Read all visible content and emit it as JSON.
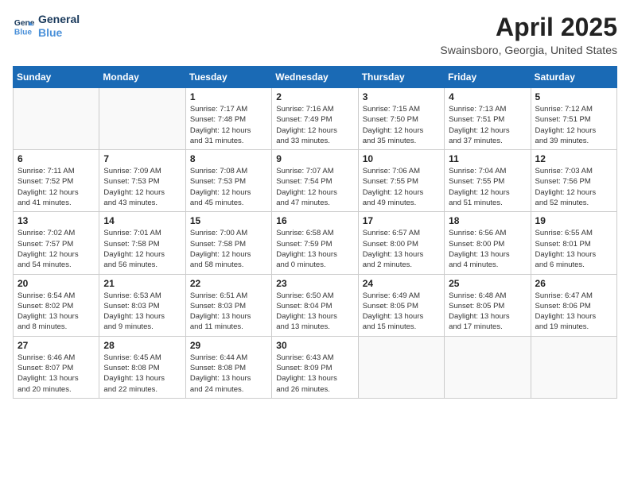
{
  "logo": {
    "line1": "General",
    "line2": "Blue"
  },
  "title": "April 2025",
  "location": "Swainsboro, Georgia, United States",
  "days_of_week": [
    "Sunday",
    "Monday",
    "Tuesday",
    "Wednesday",
    "Thursday",
    "Friday",
    "Saturday"
  ],
  "weeks": [
    [
      {
        "day": "",
        "info": ""
      },
      {
        "day": "",
        "info": ""
      },
      {
        "day": "1",
        "info": "Sunrise: 7:17 AM\nSunset: 7:48 PM\nDaylight: 12 hours\nand 31 minutes."
      },
      {
        "day": "2",
        "info": "Sunrise: 7:16 AM\nSunset: 7:49 PM\nDaylight: 12 hours\nand 33 minutes."
      },
      {
        "day": "3",
        "info": "Sunrise: 7:15 AM\nSunset: 7:50 PM\nDaylight: 12 hours\nand 35 minutes."
      },
      {
        "day": "4",
        "info": "Sunrise: 7:13 AM\nSunset: 7:51 PM\nDaylight: 12 hours\nand 37 minutes."
      },
      {
        "day": "5",
        "info": "Sunrise: 7:12 AM\nSunset: 7:51 PM\nDaylight: 12 hours\nand 39 minutes."
      }
    ],
    [
      {
        "day": "6",
        "info": "Sunrise: 7:11 AM\nSunset: 7:52 PM\nDaylight: 12 hours\nand 41 minutes."
      },
      {
        "day": "7",
        "info": "Sunrise: 7:09 AM\nSunset: 7:53 PM\nDaylight: 12 hours\nand 43 minutes."
      },
      {
        "day": "8",
        "info": "Sunrise: 7:08 AM\nSunset: 7:53 PM\nDaylight: 12 hours\nand 45 minutes."
      },
      {
        "day": "9",
        "info": "Sunrise: 7:07 AM\nSunset: 7:54 PM\nDaylight: 12 hours\nand 47 minutes."
      },
      {
        "day": "10",
        "info": "Sunrise: 7:06 AM\nSunset: 7:55 PM\nDaylight: 12 hours\nand 49 minutes."
      },
      {
        "day": "11",
        "info": "Sunrise: 7:04 AM\nSunset: 7:55 PM\nDaylight: 12 hours\nand 51 minutes."
      },
      {
        "day": "12",
        "info": "Sunrise: 7:03 AM\nSunset: 7:56 PM\nDaylight: 12 hours\nand 52 minutes."
      }
    ],
    [
      {
        "day": "13",
        "info": "Sunrise: 7:02 AM\nSunset: 7:57 PM\nDaylight: 12 hours\nand 54 minutes."
      },
      {
        "day": "14",
        "info": "Sunrise: 7:01 AM\nSunset: 7:58 PM\nDaylight: 12 hours\nand 56 minutes."
      },
      {
        "day": "15",
        "info": "Sunrise: 7:00 AM\nSunset: 7:58 PM\nDaylight: 12 hours\nand 58 minutes."
      },
      {
        "day": "16",
        "info": "Sunrise: 6:58 AM\nSunset: 7:59 PM\nDaylight: 13 hours\nand 0 minutes."
      },
      {
        "day": "17",
        "info": "Sunrise: 6:57 AM\nSunset: 8:00 PM\nDaylight: 13 hours\nand 2 minutes."
      },
      {
        "day": "18",
        "info": "Sunrise: 6:56 AM\nSunset: 8:00 PM\nDaylight: 13 hours\nand 4 minutes."
      },
      {
        "day": "19",
        "info": "Sunrise: 6:55 AM\nSunset: 8:01 PM\nDaylight: 13 hours\nand 6 minutes."
      }
    ],
    [
      {
        "day": "20",
        "info": "Sunrise: 6:54 AM\nSunset: 8:02 PM\nDaylight: 13 hours\nand 8 minutes."
      },
      {
        "day": "21",
        "info": "Sunrise: 6:53 AM\nSunset: 8:03 PM\nDaylight: 13 hours\nand 9 minutes."
      },
      {
        "day": "22",
        "info": "Sunrise: 6:51 AM\nSunset: 8:03 PM\nDaylight: 13 hours\nand 11 minutes."
      },
      {
        "day": "23",
        "info": "Sunrise: 6:50 AM\nSunset: 8:04 PM\nDaylight: 13 hours\nand 13 minutes."
      },
      {
        "day": "24",
        "info": "Sunrise: 6:49 AM\nSunset: 8:05 PM\nDaylight: 13 hours\nand 15 minutes."
      },
      {
        "day": "25",
        "info": "Sunrise: 6:48 AM\nSunset: 8:05 PM\nDaylight: 13 hours\nand 17 minutes."
      },
      {
        "day": "26",
        "info": "Sunrise: 6:47 AM\nSunset: 8:06 PM\nDaylight: 13 hours\nand 19 minutes."
      }
    ],
    [
      {
        "day": "27",
        "info": "Sunrise: 6:46 AM\nSunset: 8:07 PM\nDaylight: 13 hours\nand 20 minutes."
      },
      {
        "day": "28",
        "info": "Sunrise: 6:45 AM\nSunset: 8:08 PM\nDaylight: 13 hours\nand 22 minutes."
      },
      {
        "day": "29",
        "info": "Sunrise: 6:44 AM\nSunset: 8:08 PM\nDaylight: 13 hours\nand 24 minutes."
      },
      {
        "day": "30",
        "info": "Sunrise: 6:43 AM\nSunset: 8:09 PM\nDaylight: 13 hours\nand 26 minutes."
      },
      {
        "day": "",
        "info": ""
      },
      {
        "day": "",
        "info": ""
      },
      {
        "day": "",
        "info": ""
      }
    ]
  ]
}
